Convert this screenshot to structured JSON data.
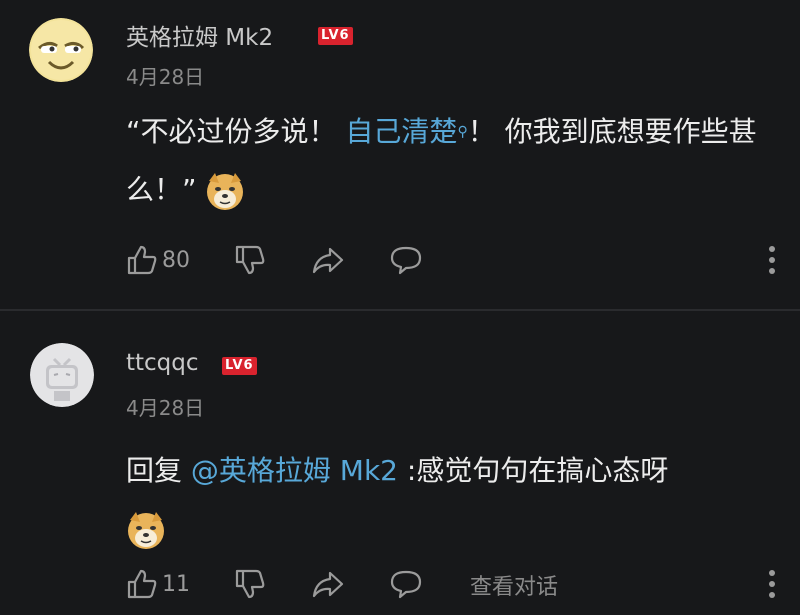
{
  "comments": [
    {
      "username": "英格拉姆 Mk2",
      "level": "LV6",
      "date": "4月28日",
      "text_before": "“不必过份多说！ ",
      "link_text": "自己清楚",
      "text_after": "！ 你我到底想要作些甚么！”",
      "likes": "80"
    },
    {
      "username": "ttcqqc",
      "level": "LV6",
      "date": "4月28日",
      "reply_prefix": "回复 ",
      "mention": "@英格拉姆 Mk2",
      "text_after": " :感觉句句在搞心态呀",
      "likes": "11",
      "view_conversation": "查看对话"
    }
  ],
  "icons": {
    "like": "thumbs-up-icon",
    "dislike": "thumbs-down-icon",
    "share": "share-icon",
    "reply": "comment-icon",
    "more": "more-vertical-icon",
    "search": "search-icon",
    "emoji": "doge-emoji-icon"
  },
  "colors": {
    "background": "#17181a",
    "link": "#58a8d8",
    "level_badge": "#d9232e"
  }
}
